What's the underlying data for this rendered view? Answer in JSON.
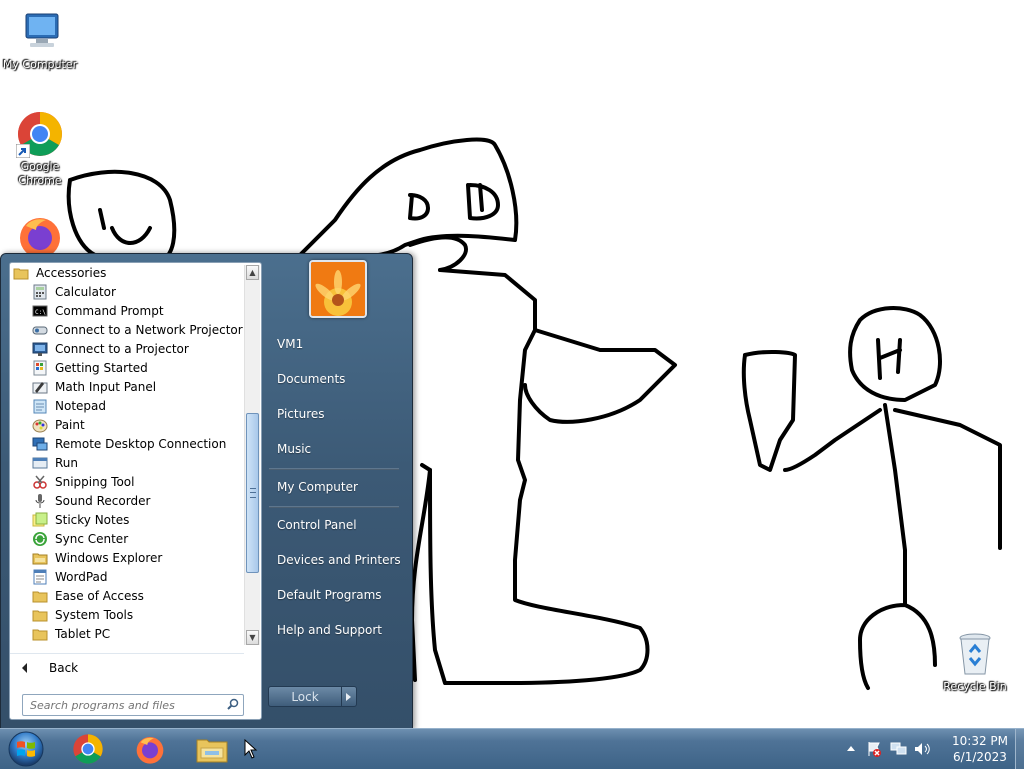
{
  "desktop": {
    "icons": [
      {
        "label": "My Computer",
        "icon": "computer-icon"
      },
      {
        "label": "Google Chrome",
        "icon": "chrome-icon"
      },
      {
        "label": "Recycle Bin",
        "icon": "recycle-bin-icon"
      }
    ]
  },
  "start_menu": {
    "programs": [
      {
        "label": "Accessories",
        "icon": "folder-icon"
      },
      {
        "label": "Calculator",
        "icon": "calculator-icon"
      },
      {
        "label": "Command Prompt",
        "icon": "command-prompt-icon"
      },
      {
        "label": "Connect to a Network Projector",
        "icon": "network-projector-icon"
      },
      {
        "label": "Connect to a Projector",
        "icon": "projector-icon"
      },
      {
        "label": "Getting Started",
        "icon": "getting-started-icon"
      },
      {
        "label": "Math Input Panel",
        "icon": "math-input-icon"
      },
      {
        "label": "Notepad",
        "icon": "notepad-icon"
      },
      {
        "label": "Paint",
        "icon": "paint-icon"
      },
      {
        "label": "Remote Desktop Connection",
        "icon": "remote-desktop-icon"
      },
      {
        "label": "Run",
        "icon": "run-icon"
      },
      {
        "label": "Snipping Tool",
        "icon": "snipping-tool-icon"
      },
      {
        "label": "Sound Recorder",
        "icon": "microphone-icon"
      },
      {
        "label": "Sticky Notes",
        "icon": "sticky-notes-icon"
      },
      {
        "label": "Sync Center",
        "icon": "sync-center-icon"
      },
      {
        "label": "Windows Explorer",
        "icon": "explorer-icon"
      },
      {
        "label": "WordPad",
        "icon": "wordpad-icon"
      },
      {
        "label": "Ease of Access",
        "icon": "folder-icon"
      },
      {
        "label": "System Tools",
        "icon": "folder-icon"
      },
      {
        "label": "Tablet PC",
        "icon": "folder-icon"
      }
    ],
    "back_label": "Back",
    "search_placeholder": "Search programs and files",
    "right_links": {
      "user": "VM1",
      "documents": "Documents",
      "pictures": "Pictures",
      "music": "Music",
      "my_computer": "My Computer",
      "control_panel": "Control Panel",
      "devices_printers": "Devices and Printers",
      "default_programs": "Default Programs",
      "help_support": "Help and Support"
    },
    "lock_label": "Lock"
  },
  "taskbar": {
    "pinned": [
      "chrome-icon",
      "firefox-icon",
      "explorer-icon"
    ],
    "clock_time": "10:32 PM",
    "clock_date": "6/1/2023"
  }
}
